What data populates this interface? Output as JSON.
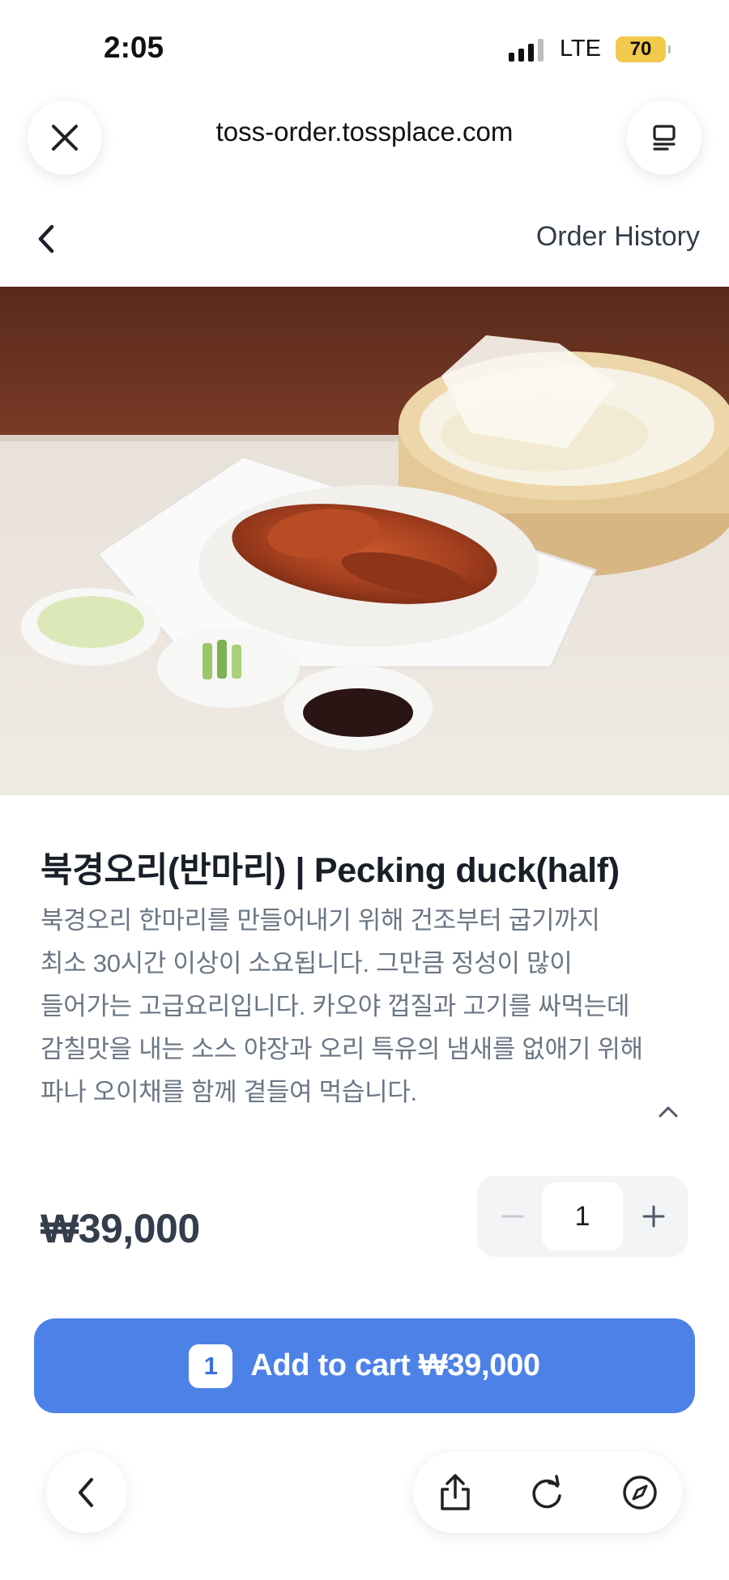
{
  "status_bar": {
    "time": "2:05",
    "network": "LTE",
    "battery": "70"
  },
  "browser": {
    "url": "toss-order.tossplace.com",
    "close_icon": "close-icon",
    "tabs_icon": "tabs-icon"
  },
  "header": {
    "back_icon": "chevron-left-icon",
    "order_history_label": "Order History"
  },
  "product": {
    "image_icon": "food-photo",
    "title": "북경오리(반마리) | Pecking duck(half)",
    "description_lines": [
      "북경오리 한마리를 만들어내기 위해 건조부터 굽기까지",
      "최소 30시간 이상이 소요됩니다. 그만큼 정성이 많이",
      "들어가는 고급요리입니다. 카오야 껍질과 고기를 싸먹는데",
      "감칠맛을 내는 소스 야장과 오리 특유의 냄새를 없애기 위해",
      "파나 오이채를 함께 곁들여 먹습니다."
    ],
    "price": "₩39,000",
    "quantity": "1"
  },
  "cart": {
    "count": "1",
    "label": "Add to cart ₩39,000"
  },
  "colors": {
    "primary": "#4c82e8",
    "battery": "#f1c94b",
    "text_dark": "#191f28",
    "text_muted": "#6b7684"
  }
}
